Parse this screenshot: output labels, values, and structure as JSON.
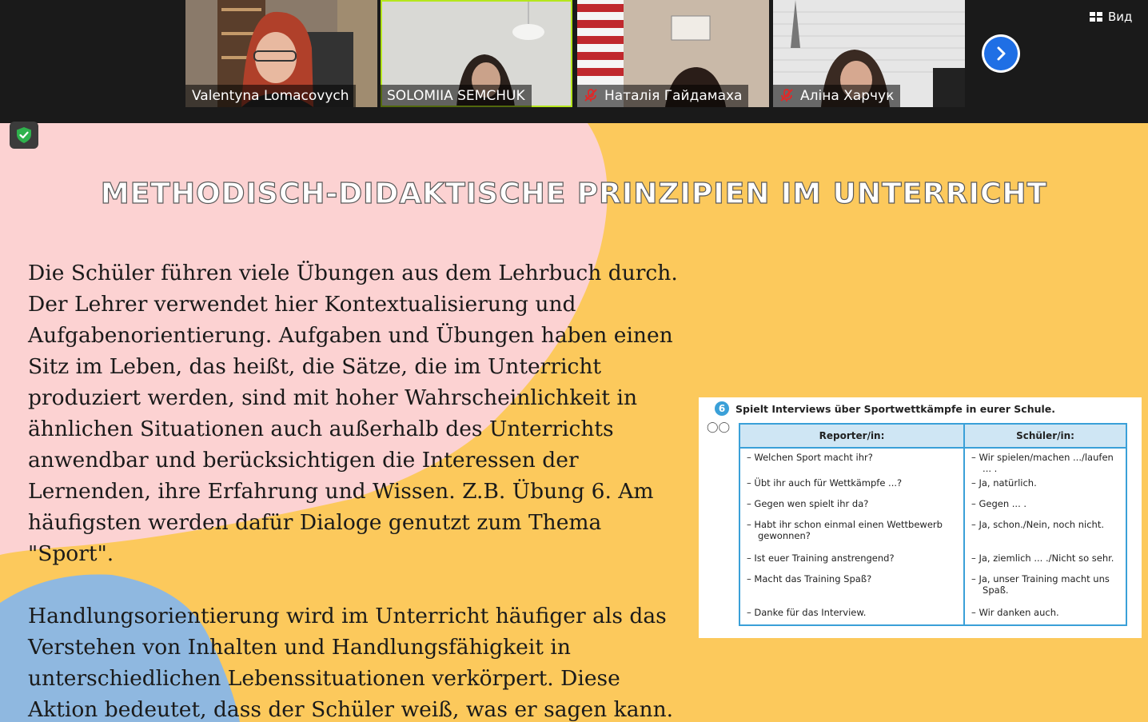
{
  "top_bar": {
    "view_label": "Вид",
    "participants": [
      {
        "name": "Valentyna Lomacovych",
        "muted": false,
        "active": false
      },
      {
        "name": "SOLOMIIA SEMCHUK",
        "muted": false,
        "active": true
      },
      {
        "name": "Наталія Гайдамаха",
        "muted": true,
        "active": false
      },
      {
        "name": "Аліна Харчук",
        "muted": true,
        "active": false
      }
    ]
  },
  "slide": {
    "title": "METHODISCH-DIDAKTISCHE PRINZIPIEN IM UNTERRICHT",
    "paragraph1": " Die Schüler führen viele Übungen aus dem Lehrbuch durch. Der Lehrer verwendet hier Kontextualisierung und Aufgabenorientierung. Aufgaben und Übungen haben einen Sitz im Leben, das heißt, die Sätze, die im Unterricht produziert werden, sind mit hoher Wahrscheinlichkeit in ähnlichen Situationen auch außerhalb des Unterrichts anwendbar und berücksichtigen die Interessen der Lernenden, ihre Erfahrung und Wissen. Z.B. Übung 6. Am häufigsten werden dafür Dialoge genutzt zum Thema \"Sport\".",
    "paragraph2": "Handlungsorientierung wird im Unterricht häufiger als das Verstehen von Inhalten und Handlungsfähigkeit in unterschiedlichen Lebenssituationen verkörpert. Diese Aktion bedeutet, dass der Schüler weiß, was er sagen kann. Der Lehrer bittet die Schüler oft, ihre Meinung zu äußern.",
    "exercise": {
      "number": "6",
      "instruction": "Spielt Interviews über Sportwettkämpfe in eurer Schule.",
      "col1_header": "Reporter/in:",
      "col2_header": "Schüler/in:",
      "rows": [
        [
          "– Welchen Sport macht ihr?",
          "– Wir spielen/machen .../laufen ... ."
        ],
        [
          "– Übt ihr auch für Wettkämpfe ...?",
          "– Ja, natürlich."
        ],
        [
          "– Gegen wen spielt ihr da?",
          "– Gegen ... ."
        ],
        [
          "– Habt ihr schon einmal einen Wettbewerb gewonnen?",
          "– Ja, schon./Nein, noch nicht."
        ],
        [
          "– Ist euer Training anstrengend?",
          "– Ja, ziemlich ... ./Nicht so sehr."
        ],
        [
          "– Macht das Training Spaß?",
          "– Ja, unser Training macht uns Spaß."
        ],
        [
          "– Danke für das Interview.",
          "– Wir danken auch."
        ]
      ]
    }
  },
  "colors": {
    "slide_bg": "#fcc95c",
    "pink": "#fcd2d2",
    "blue": "#8fb8e0",
    "accent": "#1f6fe5",
    "table_border": "#3aa0d8"
  }
}
